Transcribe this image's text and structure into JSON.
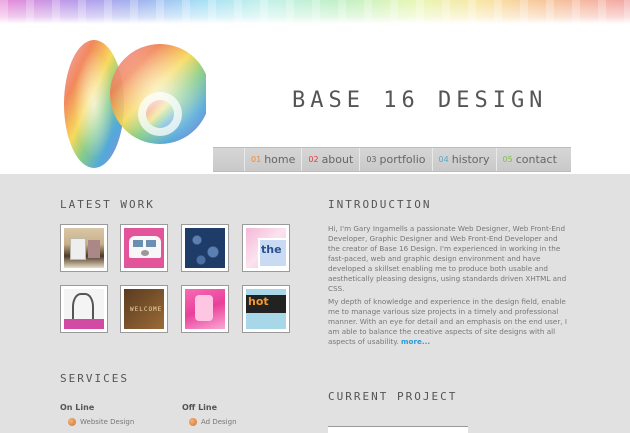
{
  "header": {
    "site_title": "BASE 16 DESIGN",
    "logo_text": "16",
    "nav": [
      {
        "num": "01",
        "label": "home"
      },
      {
        "num": "02",
        "label": "about"
      },
      {
        "num": "03",
        "label": "portfolio"
      },
      {
        "num": "04",
        "label": "history"
      },
      {
        "num": "05",
        "label": "contact"
      }
    ]
  },
  "latest_work": {
    "title": "LATEST WORK",
    "thumbs": [
      {
        "name": "kitchen"
      },
      {
        "name": "pink-van"
      },
      {
        "name": "blue-pattern"
      },
      {
        "name": "the-j"
      },
      {
        "name": "sketch-figure"
      },
      {
        "name": "welcome-mat"
      },
      {
        "name": "pink-abstract"
      },
      {
        "name": "hot-text"
      }
    ]
  },
  "introduction": {
    "title": "INTRODUCTION",
    "para1": "Hi, I'm Gary Ingamells a passionate Web Designer, Web Front-End Developer, Graphic Designer and Web Front-End Developer and the creator of Base 16 Design. I'm experienced in working in the fast-paced, web and graphic design environment and have developed a skillset enabling me to produce both usable and aesthetically pleasing designs, using standards driven XHTML and CSS.",
    "para2": "My depth of knowledge and experience in the design field, enable me to manage various size projects in a timely and professional manner. With an eye for detail and an emphasis on the end user, I am able to balance the creative aspects of site designs with all aspects of usability.",
    "more": "more..."
  },
  "services": {
    "title": "SERVICES",
    "online": {
      "title": "On Line",
      "items": [
        "Website Design"
      ]
    },
    "offline": {
      "title": "Off Line",
      "items": [
        "Ad Design"
      ]
    }
  },
  "current_project": {
    "title": "CURRENT PROJECT"
  }
}
